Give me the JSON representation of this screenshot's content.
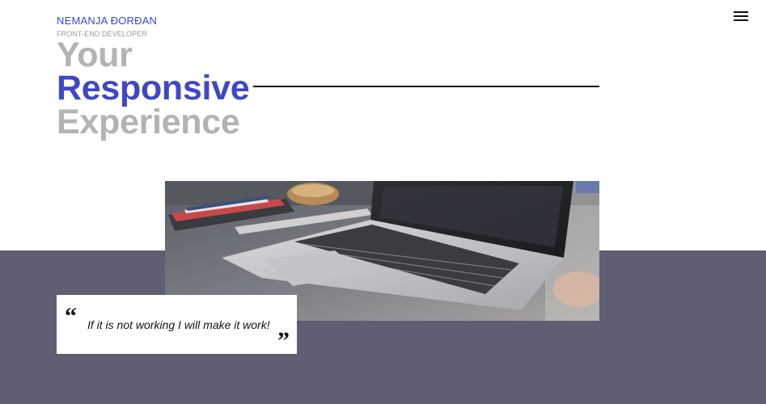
{
  "header": {
    "name": "NEMANJA ĐORĐAN",
    "role": "FRONT-END DEVELOPER",
    "menu_icon": "hamburger-menu-icon"
  },
  "hero": {
    "line1": "Your",
    "line2": "Responsive",
    "line3": "Experience"
  },
  "photo": {
    "subject": "laptop-on-desk-image"
  },
  "quote": {
    "open_mark": "“",
    "text": "If it is not working I will make it work!",
    "close_mark": "”"
  },
  "colors": {
    "accent": "#3f47c6",
    "muted": "#b3b3b3",
    "band": "#5f5e73"
  }
}
